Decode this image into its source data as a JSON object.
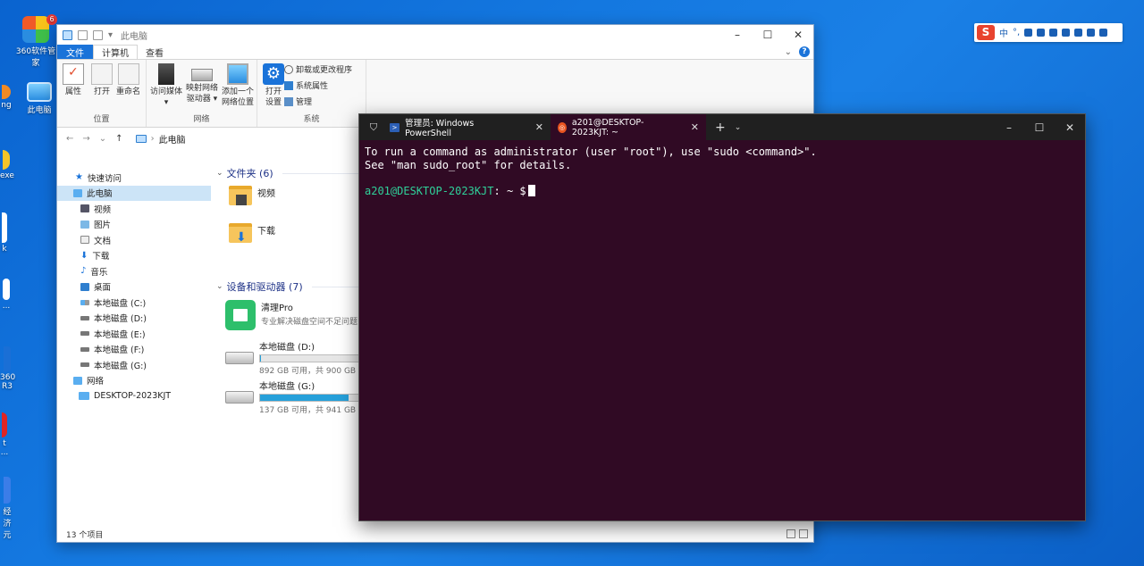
{
  "desktop": {
    "icons": [
      {
        "label": "360软件管家",
        "badge": "6"
      },
      {
        "label": "此电脑"
      },
      {
        "label": "ng"
      },
      {
        "label": "exe"
      },
      {
        "label": "k"
      },
      {
        "label": "..."
      },
      {
        "label": "360"
      },
      {
        "label": "R3"
      },
      {
        "label": "t"
      },
      {
        "label": "..."
      },
      {
        "label": "经济"
      },
      {
        "label": "元"
      }
    ]
  },
  "ime": {
    "logo": "S",
    "mode": "中",
    "punct": "°,"
  },
  "explorer": {
    "title": "此电脑",
    "controls": {
      "minimize": "–",
      "maximize": "☐",
      "close": "✕"
    },
    "tabs": {
      "file": "文件",
      "computer": "计算机",
      "view": "查看"
    },
    "ribbon": {
      "location": {
        "label": "位置",
        "properties": "属性",
        "open": "打开",
        "rename": "重命名"
      },
      "network": {
        "label": "网络",
        "access_media": "访问媒体",
        "map_drive_1": "映射网络",
        "map_drive_2": "驱动器",
        "add_location_1": "添加一个",
        "add_location_2": "网络位置"
      },
      "system": {
        "label": "系统",
        "open_settings_1": "打开",
        "open_settings_2": "设置",
        "uninstall": "卸载或更改程序",
        "sys_props": "系统属性",
        "manage": "管理"
      }
    },
    "address": {
      "path": "此电脑"
    },
    "nav": [
      {
        "label": "快速访问",
        "indent": 0
      },
      {
        "label": "此电脑",
        "indent": 0,
        "selected": true
      },
      {
        "label": "视频",
        "indent": 1
      },
      {
        "label": "图片",
        "indent": 1
      },
      {
        "label": "文档",
        "indent": 1
      },
      {
        "label": "下载",
        "indent": 1
      },
      {
        "label": "音乐",
        "indent": 1
      },
      {
        "label": "桌面",
        "indent": 1
      },
      {
        "label": "本地磁盘 (C:)",
        "indent": 1
      },
      {
        "label": "本地磁盘 (D:)",
        "indent": 1
      },
      {
        "label": "本地磁盘 (E:)",
        "indent": 1
      },
      {
        "label": "本地磁盘 (F:)",
        "indent": 1
      },
      {
        "label": "本地磁盘 (G:)",
        "indent": 1
      },
      {
        "label": "网络",
        "indent": 0
      },
      {
        "label": "DESKTOP-2023KJT",
        "indent": 1
      }
    ],
    "sections": {
      "folders": "文件夹 (6)",
      "devices": "设备和驱动器 (7)"
    },
    "folders": [
      {
        "label": "视频"
      },
      {
        "label": "下载"
      }
    ],
    "devices": [
      {
        "label": "清理Pro",
        "sub": "专业解决磁盘空间不足问题"
      },
      {
        "label": "本地磁盘 (D:)",
        "sub": "892 GB 可用，共 900 GB",
        "used": 0.009
      },
      {
        "label": "本地磁盘 (G:)",
        "sub": "137 GB 可用，共 941 GB",
        "used": 0.854
      }
    ],
    "status": "13 个项目"
  },
  "terminal": {
    "tabs": [
      {
        "label": "管理员: Windows PowerShell"
      },
      {
        "label": "a201@DESKTOP-2023KJT: ~"
      }
    ],
    "lines": [
      "To run a command as administrator (user \"root\"), use \"sudo <command>\".",
      "See \"man sudo_root\" for details."
    ],
    "prompt_user": "a201@DESKTOP-2023KJT",
    "prompt_rest": ": ~ $",
    "new_tab": "+",
    "dropdown": "⌄"
  }
}
